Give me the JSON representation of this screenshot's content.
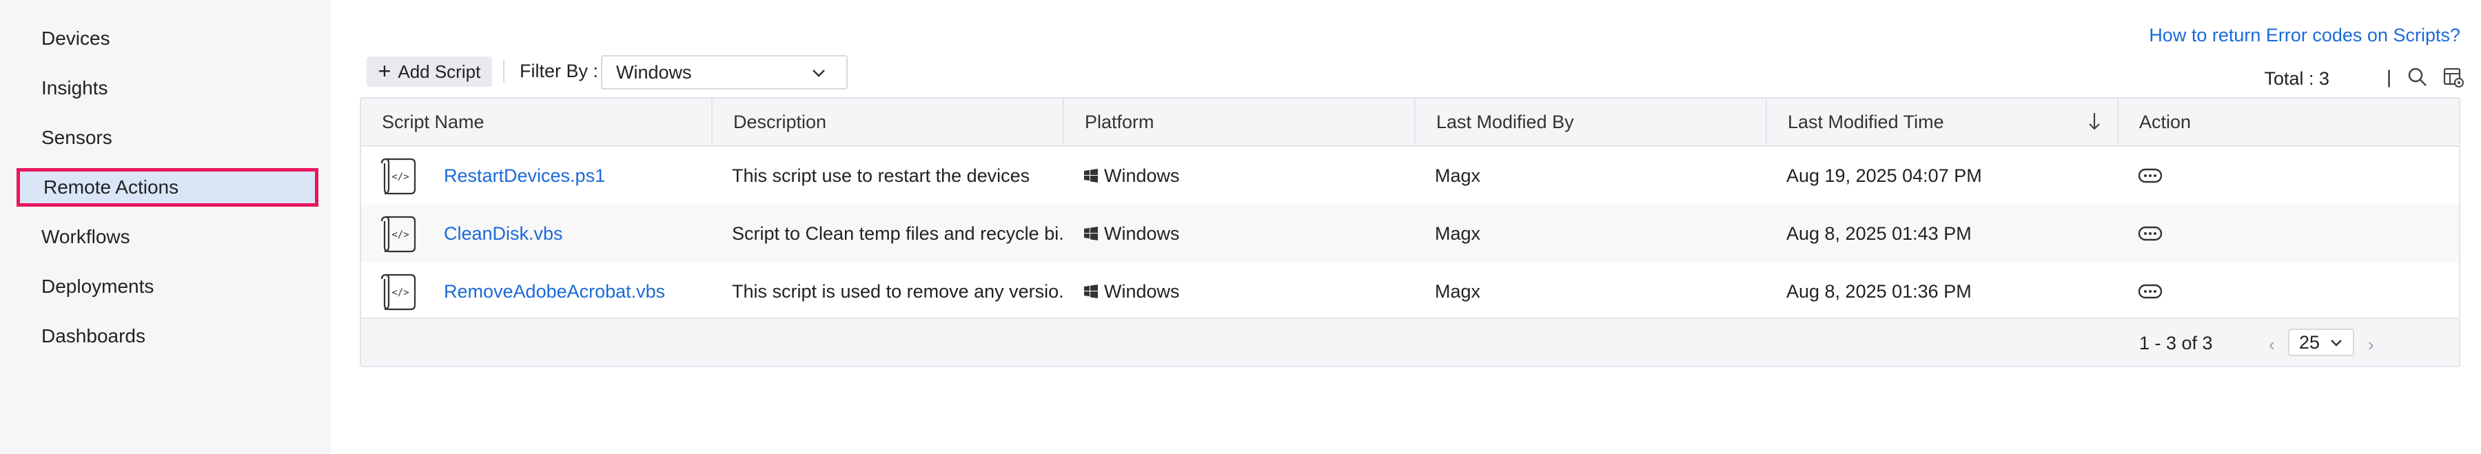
{
  "sidebar": {
    "items": [
      {
        "label": "Devices"
      },
      {
        "label": "Insights"
      },
      {
        "label": "Sensors"
      },
      {
        "label": "Remote Actions",
        "active": true
      },
      {
        "label": "Workflows"
      },
      {
        "label": "Deployments"
      },
      {
        "label": "Dashboards"
      }
    ]
  },
  "help_link": "How to return Error codes on Scripts?",
  "toolbar": {
    "add_script_label": "Add Script",
    "filter_label": "Filter By :",
    "filter_value": "Windows",
    "total_text": "Total : 3",
    "separator": "|",
    "icons": [
      "search-icon",
      "table-settings-icon"
    ]
  },
  "table": {
    "columns": [
      "Script Name",
      "Description",
      "Platform",
      "Last Modified By",
      "Last Modified Time",
      "Action"
    ],
    "sorted_column": "Last Modified Time",
    "sort_direction": "descending",
    "rows": [
      {
        "name": "RestartDevices.ps1",
        "description": "This script use to restart the devices",
        "platform": "Windows",
        "modified_by": "Magx",
        "modified_time": "Aug 19, 2025 04:07 PM"
      },
      {
        "name": "CleanDisk.vbs",
        "description": "Script to Clean temp files and recycle bi...",
        "platform": "Windows",
        "modified_by": "Magx",
        "modified_time": "Aug 8, 2025 01:43 PM"
      },
      {
        "name": "RemoveAdobeAcrobat.vbs",
        "description": "This script is used to remove any versio...",
        "platform": "Windows",
        "modified_by": "Magx",
        "modified_time": "Aug 8, 2025 01:36 PM"
      }
    ]
  },
  "pagination": {
    "range_text": "1 - 3 of 3",
    "page_size": "25",
    "prev": "‹",
    "next": "›"
  },
  "colors": {
    "accent_link": "#1a6ad8",
    "active_highlight_border": "#e8175d",
    "active_highlight_bg": "#dbe5f8",
    "sidebar_bg": "#f5f6f8"
  }
}
